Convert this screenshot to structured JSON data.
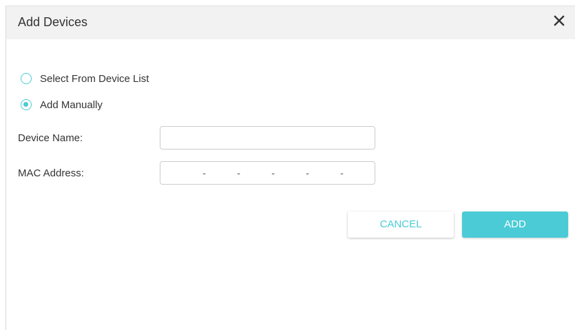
{
  "dialog": {
    "title": "Add Devices",
    "close_icon": "close-icon"
  },
  "mode_options": [
    {
      "label": "Select From Device List",
      "selected": false
    },
    {
      "label": "Add Manually",
      "selected": true
    }
  ],
  "form": {
    "device_name_label": "Device Name:",
    "device_name_value": "",
    "mac_label": "MAC Address:",
    "mac_segments": [
      "",
      "",
      "",
      "",
      "",
      ""
    ],
    "mac_separator": "-"
  },
  "buttons": {
    "cancel_label": "CANCEL",
    "add_label": "ADD"
  },
  "colors": {
    "accent": "#4acbd6",
    "header_bg": "#f2f2f2",
    "text": "#333333"
  }
}
